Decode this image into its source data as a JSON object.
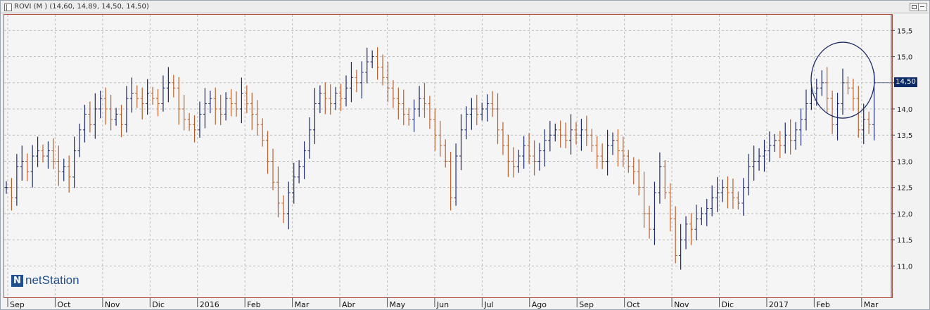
{
  "window": {
    "title": "ROVI (M ) (14,60, 14,89, 14,50, 14,50)"
  },
  "logo": {
    "mark": "N",
    "text": "netStation"
  },
  "colors": {
    "up": "#1c2a66",
    "down": "#b8612f",
    "grid": "#bdbdbd",
    "axis": "#444444",
    "tag": "#0c2a66"
  },
  "chart_data": {
    "type": "ohlc",
    "x_labels": [
      "Sep",
      "Oct",
      "Nov",
      "Dic",
      "2016",
      "Feb",
      "Mar",
      "Abr",
      "May",
      "Jun",
      "Jul",
      "Ago",
      "Sep",
      "Oct",
      "Nov",
      "Dic",
      "2017",
      "Feb",
      "Mar"
    ],
    "y_ticks": [
      "11,0",
      "11,5",
      "12,0",
      "12,5",
      "13,0",
      "13,5",
      "14,0",
      "14,5",
      "15,0",
      "15,5"
    ],
    "ylim": [
      10.4,
      15.8
    ],
    "last_price_label": "14,50",
    "last": {
      "open": 14.6,
      "high": 14.89,
      "low": 14.5,
      "close": 14.5
    },
    "annotation": "circle",
    "close_series": [
      12.5,
      12.3,
      12.9,
      13.0,
      12.8,
      13.1,
      13.2,
      13.1,
      13.2,
      13.0,
      12.8,
      12.9,
      12.7,
      13.2,
      13.6,
      13.9,
      13.7,
      14.0,
      14.2,
      14.0,
      13.8,
      13.9,
      13.7,
      14.2,
      14.3,
      14.2,
      14.1,
      14.3,
      14.2,
      14.1,
      14.4,
      14.5,
      14.4,
      14.0,
      13.8,
      13.7,
      13.6,
      13.9,
      14.1,
      14.2,
      14.0,
      13.9,
      14.2,
      14.1,
      14.0,
      14.3,
      14.1,
      13.9,
      13.7,
      13.4,
      13.0,
      12.6,
      12.2,
      12.0,
      12.4,
      12.7,
      12.9,
      13.2,
      13.6,
      14.1,
      14.3,
      14.2,
      14.1,
      14.3,
      14.2,
      14.4,
      14.6,
      14.5,
      14.7,
      14.9,
      15.0,
      14.8,
      14.6,
      14.4,
      14.2,
      14.1,
      13.9,
      13.8,
      14.0,
      14.2,
      14.1,
      13.8,
      13.5,
      13.3,
      13.0,
      12.3,
      13.1,
      13.6,
      13.9,
      14.0,
      13.9,
      14.0,
      14.1,
      14.0,
      13.6,
      13.3,
      13.0,
      12.9,
      13.1,
      13.3,
      13.1,
      13.0,
      13.2,
      13.4,
      13.5,
      13.6,
      13.5,
      13.4,
      13.6,
      13.5,
      13.6,
      13.5,
      13.3,
      13.1,
      13.0,
      13.3,
      13.4,
      13.2,
      13.1,
      12.9,
      12.8,
      12.5,
      12.0,
      11.7,
      12.4,
      12.9,
      12.4,
      11.9,
      11.2,
      11.5,
      11.8,
      11.7,
      11.9,
      12.0,
      12.1,
      12.3,
      12.4,
      12.5,
      12.4,
      12.3,
      12.2,
      12.5,
      12.9,
      13.0,
      13.1,
      13.2,
      13.3,
      13.4,
      13.3,
      13.5,
      13.4,
      13.6,
      13.8,
      14.1,
      14.3,
      14.4,
      14.5,
      14.2,
      13.7,
      14.1,
      14.5,
      14.4,
      14.2,
      13.6,
      13.8,
      13.7,
      14.5
    ]
  }
}
